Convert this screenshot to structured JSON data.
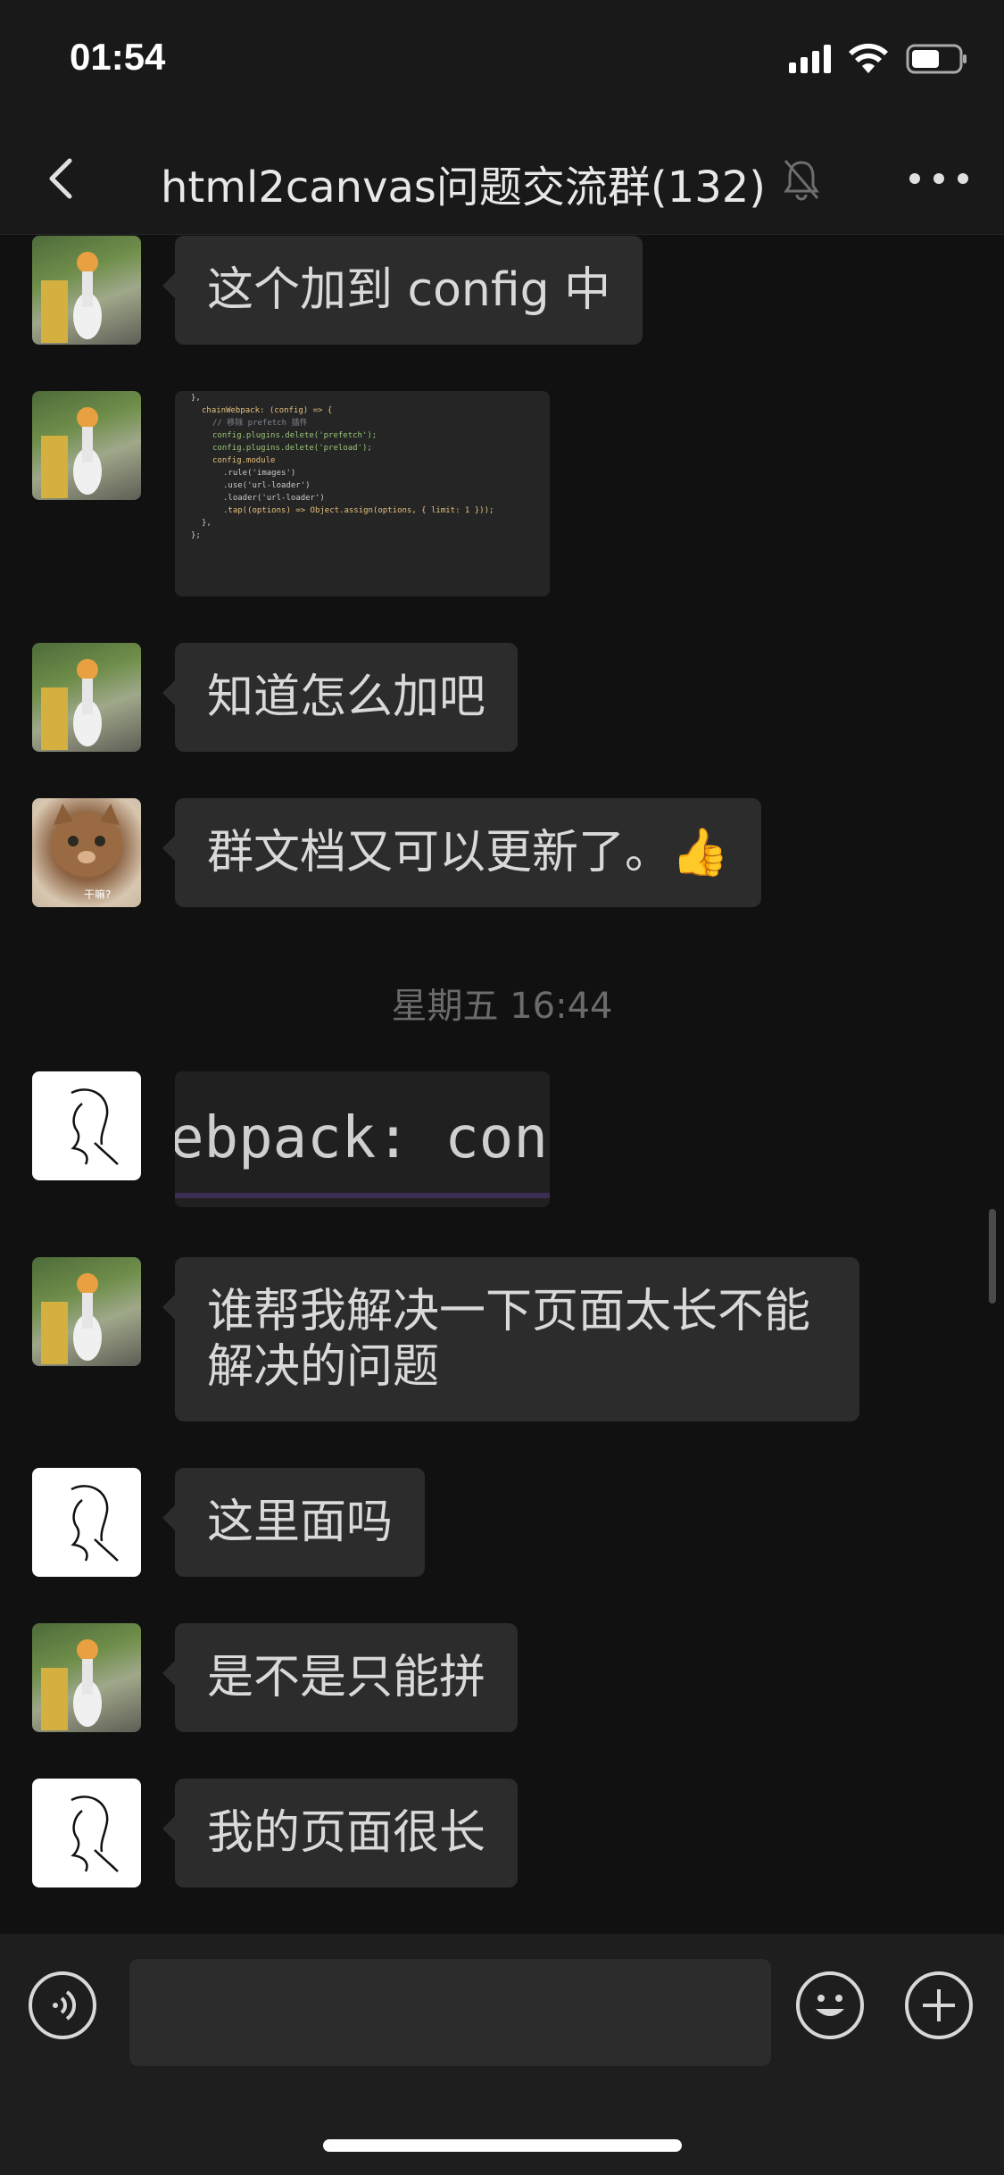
{
  "status_bar": {
    "time": "01:54"
  },
  "header": {
    "title": "html2canvas问题交流群(132)"
  },
  "messages": [
    {
      "avatar": "garden-avatar",
      "text": "这个加到 config 中"
    },
    {
      "avatar": "garden-avatar",
      "type": "image",
      "code_lines": [
        "},",
        "chainWebpack: (config) => {",
        "// 移除 prefetch 插件",
        "config.plugins.delete('prefetch');",
        "config.plugins.delete('preload');",
        "config.module",
        ".rule('images')",
        ".use('url-loader')",
        ".loader('url-loader')",
        ".tap((options) => Object.assign(options, { limit: 1 }));",
        "},",
        "};"
      ]
    },
    {
      "avatar": "garden-avatar",
      "text": "知道怎么加吧"
    },
    {
      "avatar": "cat-avatar",
      "avatar_caption": "干嘛?",
      "text": "群文档又可以更新了。👍"
    },
    {
      "avatar": "line-art-avatar",
      "type": "image",
      "image_text": "ebpack: con"
    },
    {
      "avatar": "garden-avatar",
      "text_line1": "谁帮我解决一下页面太长不能",
      "text_line2": "解决的问题"
    },
    {
      "avatar": "line-art-avatar",
      "text": "这里面吗"
    },
    {
      "avatar": "garden-avatar",
      "text": "是不是只能拼"
    },
    {
      "avatar": "line-art-avatar",
      "text": "我的页面很长"
    }
  ],
  "timestamp": "星期五 16:44",
  "input_bar": {
    "placeholder": ""
  }
}
